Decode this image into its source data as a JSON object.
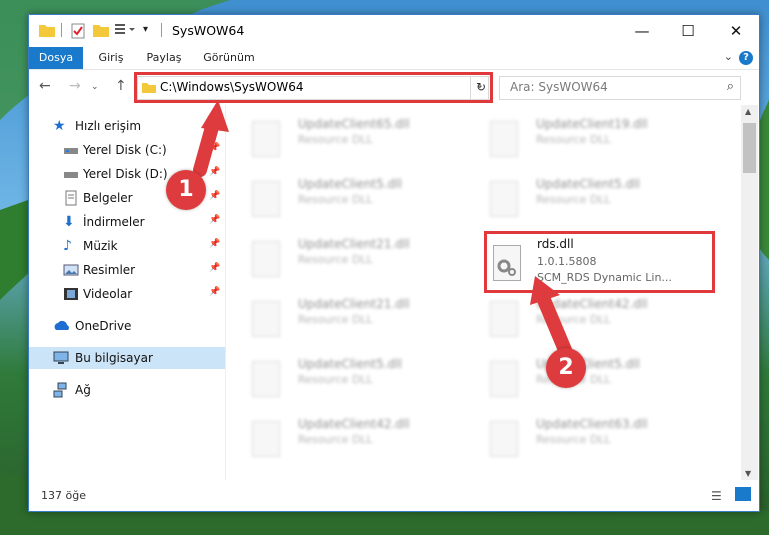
{
  "window": {
    "title": "SysWOW64",
    "controls": {
      "minimize": "—",
      "maximize": "☐",
      "close": "✕"
    }
  },
  "ribbon": {
    "tabs": [
      "Dosya",
      "Giriş",
      "Paylaş",
      "Görünüm"
    ],
    "help": "?"
  },
  "address": {
    "path": "C:\\Windows\\SysWOW64",
    "search_placeholder": "Ara: SysWOW64"
  },
  "nav": {
    "quick_access": "Hızlı erişim",
    "items": [
      {
        "label": "Yerel Disk (C:)"
      },
      {
        "label": "Yerel Disk (D:)"
      },
      {
        "label": "Belgeler"
      },
      {
        "label": "İndirmeler"
      },
      {
        "label": "Müzik"
      },
      {
        "label": "Resimler"
      },
      {
        "label": "Videolar"
      }
    ],
    "onedrive": "OneDrive",
    "this_pc": "Bu bilgisayar",
    "network": "Ağ"
  },
  "files": [
    {
      "name": "UpdateClient65.dll",
      "desc": "Resource DLL"
    },
    {
      "name": "UpdateClient19.dll",
      "desc": "Resource DLL"
    },
    {
      "name": "UpdateClient5.dll",
      "desc": "Resource DLL"
    },
    {
      "name": "UpdateClient5.dll",
      "desc": "Resource DLL"
    },
    {
      "name": "UpdateClient21.dll",
      "desc": "Resource DLL"
    },
    {
      "name": "UpdateClient21.dll",
      "desc": "Resource DLL"
    },
    {
      "name": "UpdateClient42.dll",
      "desc": "Resource DLL"
    },
    {
      "name": "UpdateClient5.dll",
      "desc": "Resource DLL"
    },
    {
      "name": "UpdateClient5.dll",
      "desc": "Resource DLL"
    },
    {
      "name": "UpdateClient42.dll",
      "desc": "Resource DLL"
    },
    {
      "name": "UpdateClient63.dll",
      "desc": "Resource DLL"
    }
  ],
  "highlighted_file": {
    "name": "rds.dll",
    "version": "1.0.1.5808",
    "description": "SCM_RDS Dynamic Lin..."
  },
  "status": {
    "count": "137 öğe"
  },
  "markers": {
    "one": "1",
    "two": "2"
  },
  "colors": {
    "accent": "#1979ca",
    "annotation": "#e0393b"
  }
}
